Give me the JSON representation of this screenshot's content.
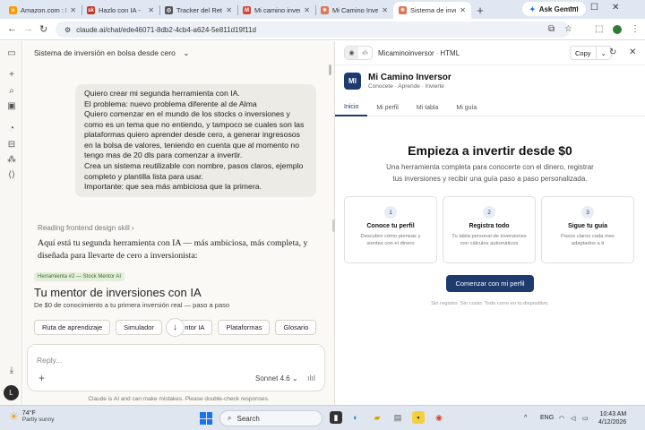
{
  "browser": {
    "tabs": [
      {
        "title": "Amazon.com : Mi",
        "favicon": "amazon-icon",
        "color": "#ff9900",
        "glyph": "a",
        "active": false
      },
      {
        "title": "Hazlo con IA - ",
        "favicon": "hazlo-icon",
        "color": "#c0392b",
        "glyph": "sk",
        "active": false
      },
      {
        "title": "Tracker del Reto N",
        "favicon": "globe-icon",
        "color": "#555555",
        "glyph": "◎",
        "active": false
      },
      {
        "title": "Mi camino inversor",
        "favicon": "gmail-icon",
        "color": "#d44638",
        "glyph": "M",
        "active": false
      },
      {
        "title": "Mi Camino Inverso",
        "favicon": "claude-icon",
        "color": "#d97757",
        "glyph": "✳",
        "active": false
      },
      {
        "title": "Sistema de inversi",
        "favicon": "claude-icon",
        "color": "#d97757",
        "glyph": "✳",
        "active": true
      }
    ],
    "gemini_label": "Ask Gemini",
    "url": "claude.ai/chat/ede46071-8db2-4cb4-a624-5e811d19f11d"
  },
  "chat": {
    "title": "Sistema de inversión en bolsa desde cero",
    "user_message": [
      "Quiero crear mi segunda herramienta con IA.",
      "El problema: nuevo problema diferente al de Alma",
      "Quiero comenzar en el mundo de los stocks o inversiones y",
      "como es un tema que no entiendo, y tampoco se cuales son las",
      "plataformas quiero aprender desde cero, a generar ingresosos",
      "en la bolsa de valores, teniendo en cuenta que al momento no",
      "tengo mas de 20 dls para comenzar a invertir.",
      "Crea un sistema reutilizable con nombre, pasos claros, ejemplo",
      "completo y plantilla lista para usar.",
      "Importante: que sea más ambiciosa que la primera."
    ],
    "skill_line": "Reading frontend design skill",
    "response": "Aquí está tu segunda herramienta con IA — más ambiciosa, más completa, y diseñada para llevarte de cero a inversionista:",
    "badge": "Herramienta #2 — Stock Mentor AI",
    "tool_title": "Tu mentor de inversiones con IA",
    "tool_subtitle": "De $0 de conocimiento a tu primera inversión real — paso a paso",
    "chips": [
      "Ruta de aprendizaje",
      "Simulador",
      "Mentor IA",
      "Plataformas",
      "Glosario"
    ],
    "composer_placeholder": "Reply...",
    "model": "Sonnet 4.6",
    "disclaimer": "Claude is AI and can make mistakes. Please double-check responses.",
    "avatar_initial": "L"
  },
  "artifact": {
    "name": "Micaminoinversor",
    "type": "HTML",
    "copy_label": "Copy",
    "app": {
      "logo": "MI",
      "name": "Mi Camino Inversor",
      "tagline": "Conocete · Aprende · Invierte",
      "tabs": [
        "Inicio",
        "Mi perfil",
        "Mi tabla",
        "Mi guía"
      ],
      "hero_title": "Empieza a invertir desde $0",
      "hero_sub": "Una herramienta completa para conocerte con el dinero, registrar tus inversiones y recibir una guía paso a paso personalizada.",
      "cards": [
        {
          "n": "1",
          "title": "Conoce tu perfil",
          "desc": "Descubre cómo piensas y sientes con el dinero"
        },
        {
          "n": "2",
          "title": "Registra todo",
          "desc": "Tu tabla personal de inversiones con cálculos automáticos"
        },
        {
          "n": "3",
          "title": "Sigue tu guía",
          "desc": "Pasos claros cada mes adaptados a ti"
        }
      ],
      "cta": "Comenzar con mi perfil",
      "footer": "Sin registro. Sin costo. Todo corre en tu dispositivo."
    }
  },
  "taskbar": {
    "temp": "74°F",
    "weather": "Partly sunny",
    "search_label": "Search",
    "lang": "ENG",
    "time": "10:43 AM",
    "date": "4/12/2026"
  }
}
